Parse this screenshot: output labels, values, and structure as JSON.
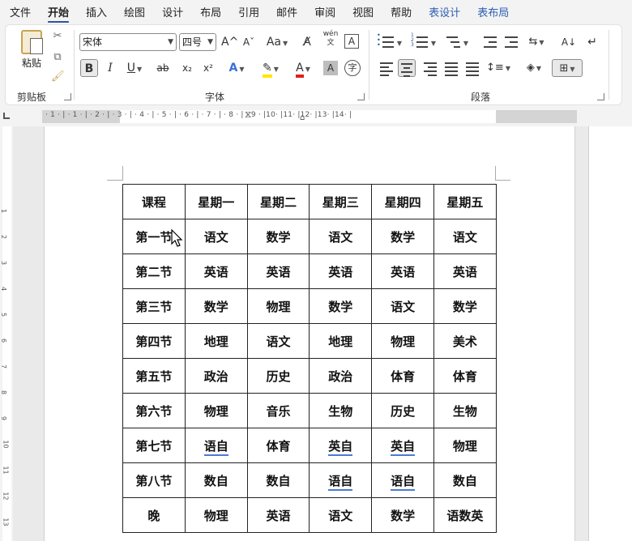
{
  "menu": {
    "tabs": [
      {
        "label": "文件"
      },
      {
        "label": "开始"
      },
      {
        "label": "插入"
      },
      {
        "label": "绘图"
      },
      {
        "label": "设计"
      },
      {
        "label": "布局"
      },
      {
        "label": "引用"
      },
      {
        "label": "邮件"
      },
      {
        "label": "审阅"
      },
      {
        "label": "视图"
      },
      {
        "label": "帮助"
      },
      {
        "label": "表设计"
      },
      {
        "label": "表布局"
      }
    ],
    "active": "开始"
  },
  "ribbon": {
    "clipboard": {
      "paste_label": "粘贴",
      "group_label": "剪贴板"
    },
    "font": {
      "font_name": "宋体",
      "font_size": "四号",
      "group_label": "字体",
      "grow": "A^",
      "shrink": "Aˇ",
      "case": "Aa",
      "phonetic_top": "wén",
      "phonetic_bottom": "文",
      "border_char": "A",
      "bold": "B",
      "italic": "I",
      "underline": "U",
      "strike": "ab",
      "subscript": "x₂",
      "superscript": "x²",
      "effects": "A",
      "font_color": "A",
      "shading": "A",
      "enclose": "字"
    },
    "paragraph": {
      "group_label": "段落"
    },
    "colors": {
      "accent": "#2b579a",
      "highlight": "#ffe600",
      "font_color": "#e0201b",
      "text_effect": "#3b6fd8"
    }
  },
  "ruler": {
    "text": "· 1 · | · 1 · | · 2 · | · 3 · | · 4 · | · 5 · | · 6 · | · 7 · | · 8 · | · 9 · |10· |11· |12· |13· |14· |"
  },
  "vruler": [
    "1",
    "2",
    "3",
    "4",
    "5",
    "6",
    "7",
    "8",
    "9",
    "10",
    "11",
    "12",
    "13"
  ],
  "schedule": {
    "rows": [
      [
        "课程",
        "星期一",
        "星期二",
        "星期三",
        "星期四",
        "星期五"
      ],
      [
        "第一节",
        "语文",
        "数学",
        "语文",
        "数学",
        "语文"
      ],
      [
        "第二节",
        "英语",
        "英语",
        "英语",
        "英语",
        "英语"
      ],
      [
        "第三节",
        "数学",
        "物理",
        "数学",
        "语文",
        "数学"
      ],
      [
        "第四节",
        "地理",
        "语文",
        "地理",
        "物理",
        "美术"
      ],
      [
        "第五节",
        "政治",
        "历史",
        "政治",
        "体育",
        "体育"
      ],
      [
        "第六节",
        "物理",
        "音乐",
        "生物",
        "历史",
        "生物"
      ],
      [
        "第七节",
        "语自",
        "体育",
        "英自",
        "英自",
        "物理"
      ],
      [
        "第八节",
        "数自",
        "数自",
        "语自",
        "语自",
        "数自"
      ],
      [
        "晚",
        "物理",
        "英语",
        "语文",
        "数学",
        "语数英"
      ]
    ]
  }
}
